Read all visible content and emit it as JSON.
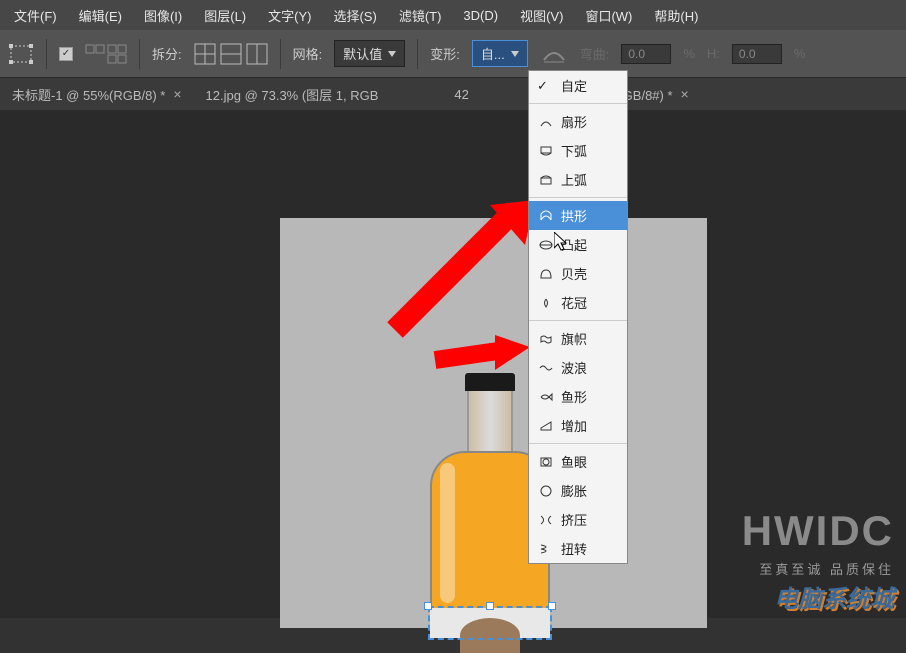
{
  "menu": {
    "items": [
      "文件(F)",
      "编辑(E)",
      "图像(I)",
      "图层(L)",
      "文字(Y)",
      "选择(S)",
      "滤镜(T)",
      "3D(D)",
      "视图(V)",
      "窗口(W)",
      "帮助(H)"
    ]
  },
  "options": {
    "split_label": "拆分:",
    "grid_label": "网格:",
    "grid_value": "默认值",
    "warp_label": "变形:",
    "warp_value": "自...",
    "bend_label": "弯曲:",
    "bend_value": "0.0",
    "percent": "%",
    "h_label": "H:",
    "h_value": "0.0"
  },
  "tabs": [
    {
      "label": "未标题-1 @ 55%(RGB/8) *"
    },
    {
      "label": "12.jpg @ 73.3% (图层 1, RGB"
    },
    {
      "label": "42"
    },
    {
      "label": "(图层 1, RGB/8#) *"
    }
  ],
  "warp_menu": {
    "items": [
      {
        "label": "自定",
        "checked": true
      },
      {
        "sep": true
      },
      {
        "label": "扇形",
        "icon": "fan"
      },
      {
        "label": "下弧",
        "icon": "arc-down"
      },
      {
        "label": "上弧",
        "icon": "arc-up"
      },
      {
        "sep": true
      },
      {
        "label": "拱形",
        "icon": "arch",
        "selected": true
      },
      {
        "label": "凸起",
        "icon": "bulge"
      },
      {
        "label": "贝壳",
        "icon": "shell"
      },
      {
        "label": "花冠",
        "icon": "flower"
      },
      {
        "sep": true
      },
      {
        "label": "旗帜",
        "icon": "flag"
      },
      {
        "label": "波浪",
        "icon": "wave"
      },
      {
        "label": "鱼形",
        "icon": "fish"
      },
      {
        "label": "增加",
        "icon": "rise"
      },
      {
        "sep": true
      },
      {
        "label": "鱼眼",
        "icon": "fisheye"
      },
      {
        "label": "膨胀",
        "icon": "inflate"
      },
      {
        "label": "挤压",
        "icon": "squeeze"
      },
      {
        "label": "扭转",
        "icon": "twist"
      }
    ]
  },
  "watermark": {
    "main": "HWIDC",
    "sub": "至真至诚 品质保住",
    "logo": "电脑系统城"
  }
}
